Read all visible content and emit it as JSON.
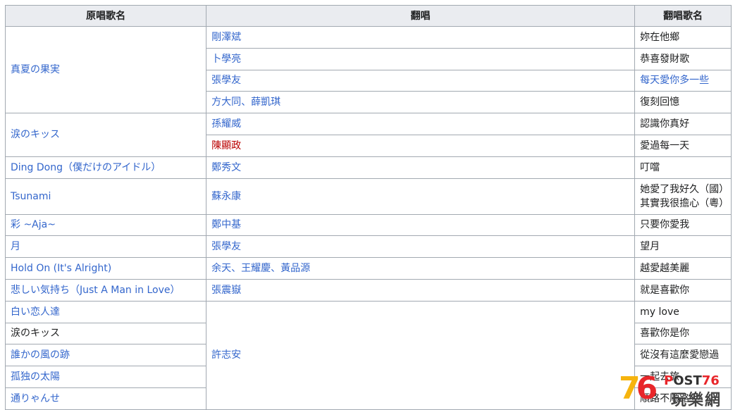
{
  "table": {
    "headers": [
      "原唱歌名",
      "翻唱",
      "翻唱歌名"
    ],
    "groups": [
      {
        "original": "真夏の果実",
        "original_link": true,
        "rows": [
          {
            "cover": "剛澤斌",
            "cover_style": "link",
            "song": "妳在他鄉",
            "song_style": "plain"
          },
          {
            "cover": "卜學亮",
            "cover_style": "link",
            "song": "恭喜發財歌",
            "song_style": "plain"
          },
          {
            "cover": "張學友",
            "cover_style": "link",
            "song": "每天愛你多一些",
            "song_style": "link"
          },
          {
            "cover": "方大同、薛凱琪",
            "cover_style": "link",
            "song": "復刻回憶",
            "song_style": "plain"
          }
        ]
      },
      {
        "original": "涙のキッス",
        "original_link": true,
        "rows": [
          {
            "cover": "孫耀威",
            "cover_style": "link",
            "song": "認識你真好",
            "song_style": "plain"
          },
          {
            "cover": "陳顯政",
            "cover_style": "red",
            "song": "愛過每一天",
            "song_style": "plain"
          }
        ]
      },
      {
        "original": "Ding Dong（僕だけのアイドル）",
        "original_link": true,
        "rows": [
          {
            "cover": "鄭秀文",
            "cover_style": "link",
            "song": "叮噹",
            "song_style": "plain"
          }
        ]
      },
      {
        "original": "Tsunami",
        "original_link": true,
        "rows": [
          {
            "cover": "蘇永康",
            "cover_style": "link",
            "song": "她愛了我好久（國）",
            "song2": "其實我很擔心（粵）",
            "song_style": "plain"
          }
        ]
      },
      {
        "original": "彩 ~Aja~",
        "original_link": true,
        "rows": [
          {
            "cover": "鄭中基",
            "cover_style": "link",
            "song": "只要你愛我",
            "song_style": "plain"
          }
        ]
      },
      {
        "original": "月",
        "original_link": true,
        "rows": [
          {
            "cover": "張學友",
            "cover_style": "link",
            "song": "望月",
            "song_style": "plain"
          }
        ]
      },
      {
        "original": "Hold On (It's Alright)",
        "original_link": true,
        "rows": [
          {
            "cover": "余天、王耀慶、黃品源",
            "cover_style": "link",
            "song": "越愛越美麗",
            "song_style": "plain"
          }
        ]
      },
      {
        "original": "悲しい気持ち（Just A Man in Love）",
        "original_link": true,
        "rows": [
          {
            "cover": "張震嶽",
            "cover_style": "link",
            "song": "就是喜歡你",
            "song_style": "plain"
          }
        ]
      }
    ],
    "xu_group": {
      "cover": "許志安",
      "rows": [
        {
          "original": "白い恋人達",
          "original_link": true,
          "song": "my love"
        },
        {
          "original": "涙のキッス",
          "original_link": false,
          "song": "喜歡你是你"
        },
        {
          "original": "誰かの風の跡",
          "original_link": true,
          "song": "從沒有這麼愛戀過"
        },
        {
          "original": "孤独の太陽",
          "original_link": true,
          "song": "一起去旅"
        },
        {
          "original": "通りゃんせ",
          "original_link": true,
          "song": "順路不順路"
        }
      ]
    }
  },
  "watermark": {
    "num_7": "7",
    "num_6": "6",
    "post_a": "P",
    "post_b": "OST",
    "post_c": "76",
    "cn": "玩樂網"
  },
  "colors": {
    "link": "#3366cc",
    "redlink": "#ba0000",
    "header_bg": "#eaecf0",
    "border": "#a2a9b1"
  }
}
